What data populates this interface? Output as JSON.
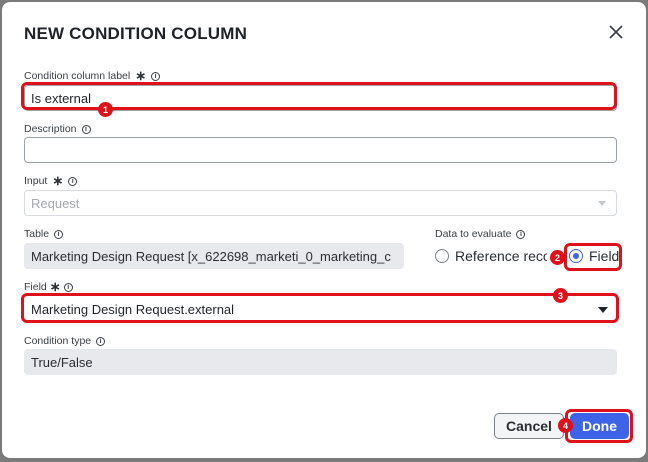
{
  "dialog": {
    "title": "NEW CONDITION COLUMN",
    "close_icon": "close-icon"
  },
  "fields": {
    "label": {
      "label": "Condition column label",
      "required": "∗",
      "value": "Is external"
    },
    "description": {
      "label": "Description",
      "value": ""
    },
    "input": {
      "label": "Input",
      "required": "∗",
      "placeholder": "Request"
    },
    "table": {
      "label": "Table",
      "value": "Marketing Design Request [x_622698_marketi_0_marketing_c"
    },
    "data_to_evaluate": {
      "label": "Data to evaluate",
      "options": [
        {
          "label": "Reference record",
          "checked": false
        },
        {
          "label": "Field",
          "checked": true
        }
      ]
    },
    "field": {
      "label": "Field",
      "required": "∗",
      "value": "Marketing Design Request.external"
    },
    "condition_type": {
      "label": "Condition type",
      "value": "True/False"
    }
  },
  "buttons": {
    "cancel": "Cancel",
    "done": "Done"
  },
  "annotations": {
    "b1": "1",
    "b2": "2",
    "b3": "3",
    "b4": "4"
  },
  "colors": {
    "accent": "#3d63e6",
    "annotation": "#e0101a"
  }
}
